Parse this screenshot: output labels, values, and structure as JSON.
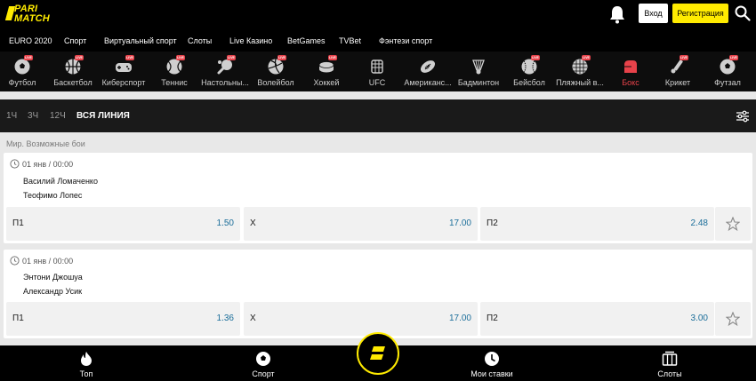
{
  "header": {
    "logo_line1": "PARI",
    "logo_line2": "MATCH",
    "login_label": "Вход",
    "register_label": "Регистрация"
  },
  "topnav": [
    "EURO 2020",
    "Спорт",
    "Виртуальный спорт",
    "Слоты",
    "Live Казино",
    "BetGames",
    "TVBet",
    "Фэнтези спорт"
  ],
  "sports": [
    {
      "label": "Футбол",
      "icon": "soccer-ball-icon",
      "live": true
    },
    {
      "label": "Баскетбол",
      "icon": "basketball-icon",
      "live": true
    },
    {
      "label": "Киберспорт",
      "icon": "gamepad-icon",
      "live": true
    },
    {
      "label": "Теннис",
      "icon": "tennis-ball-icon",
      "live": true
    },
    {
      "label": "Настольны...",
      "icon": "table-tennis-icon",
      "live": true
    },
    {
      "label": "Волейбол",
      "icon": "volleyball-icon",
      "live": true
    },
    {
      "label": "Хоккей",
      "icon": "hockey-puck-icon",
      "live": true
    },
    {
      "label": "UFC",
      "icon": "ufc-icon",
      "live": false
    },
    {
      "label": "Американс...",
      "icon": "american-football-icon",
      "live": false
    },
    {
      "label": "Бадминтон",
      "icon": "shuttlecock-icon",
      "live": false
    },
    {
      "label": "Бейсбол",
      "icon": "baseball-icon",
      "live": true
    },
    {
      "label": "Пляжный в...",
      "icon": "beach-volleyball-icon",
      "live": true
    },
    {
      "label": "Бокс",
      "icon": "boxing-glove-icon",
      "live": false,
      "active": true
    },
    {
      "label": "Крикет",
      "icon": "cricket-icon",
      "live": true
    },
    {
      "label": "Футзал",
      "icon": "futsal-ball-icon",
      "live": true
    }
  ],
  "live_badge": "LIVE",
  "filters": {
    "f1": "1Ч",
    "f3": "3Ч",
    "f12": "12Ч",
    "all": "ВСЯ ЛИНИЯ"
  },
  "tournament": "Мир. Возможные бои",
  "events": [
    {
      "time": "01 янв / 00:00",
      "team1": "Василий Ломаченко",
      "team2": "Теофимо Лопес",
      "odds": [
        {
          "k": "П1",
          "v": "1.50"
        },
        {
          "k": "Х",
          "v": "17.00"
        },
        {
          "k": "П2",
          "v": "2.48"
        }
      ]
    },
    {
      "time": "01 янв / 00:00",
      "team1": "Энтони Джошуа",
      "team2": "Александр Усик",
      "odds": [
        {
          "k": "П1",
          "v": "1.36"
        },
        {
          "k": "Х",
          "v": "17.00"
        },
        {
          "k": "П2",
          "v": "3.00"
        }
      ]
    }
  ],
  "bottomnav": {
    "top": "Топ",
    "sport": "Спорт",
    "mybets": "Мои ставки",
    "slots": "Слоты"
  },
  "colors": {
    "brand_yellow": "#ffeb00",
    "live_red": "#e8424a",
    "odds_blue": "#1b6e9a",
    "active_sport": "#e8424a"
  }
}
